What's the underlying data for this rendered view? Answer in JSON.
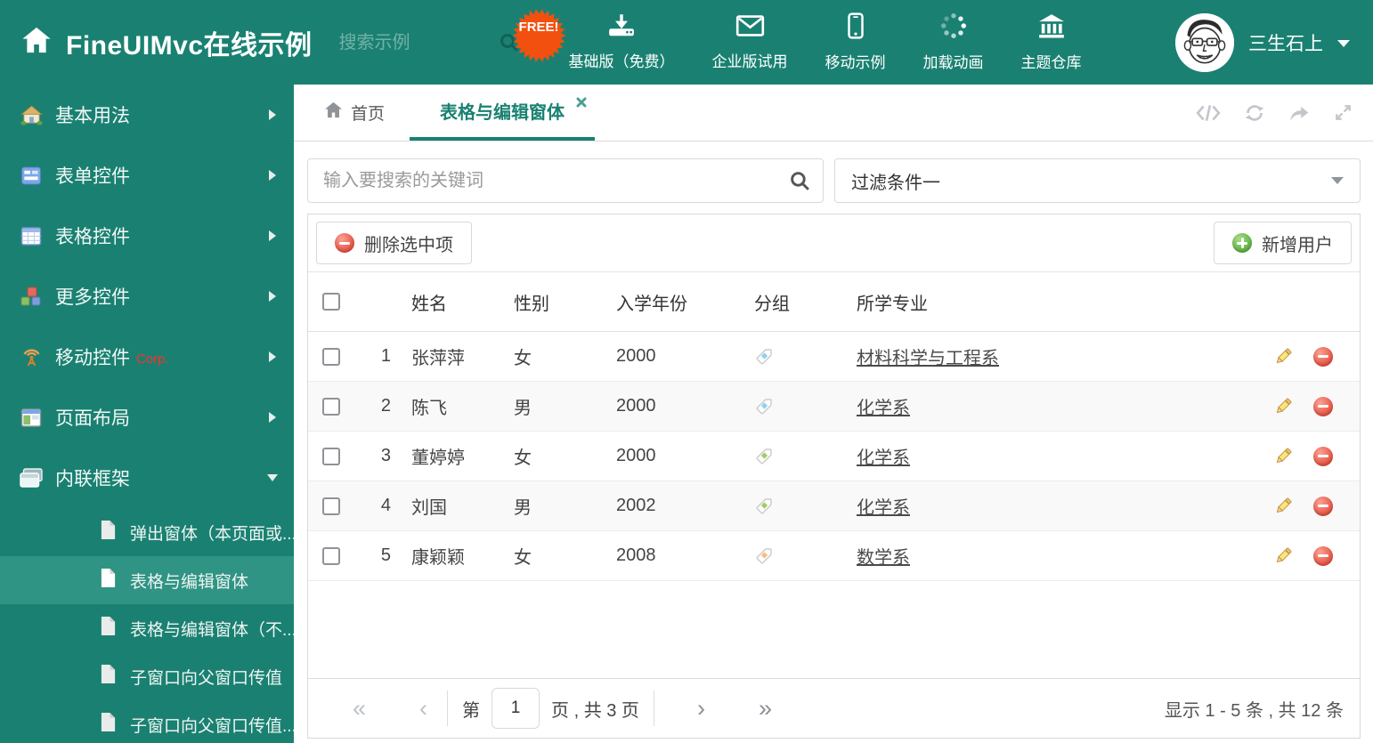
{
  "colors": {
    "accent": "#1a8172",
    "badge": "#f2500f",
    "add_green": "#57ae3d",
    "delete_red": "#e44c3c"
  },
  "header": {
    "title": "FineUIMvc在线示例",
    "search_placeholder": "搜索示例",
    "badge": "FREE!",
    "nav_items": [
      {
        "label": "基础版（免费）",
        "icon": "download-icon"
      },
      {
        "label": "企业版试用",
        "icon": "envelope-icon"
      },
      {
        "label": "移动示例",
        "icon": "mobile-icon"
      },
      {
        "label": "加载动画",
        "icon": "spinner-icon"
      },
      {
        "label": "主题仓库",
        "icon": "bank-icon"
      }
    ],
    "user": {
      "name": "三生石上",
      "avatar": "cartoon-face-avatar"
    }
  },
  "sidebar": {
    "items": [
      {
        "label": "基本用法",
        "icon": "house-icon"
      },
      {
        "label": "表单控件",
        "icon": "form-icon"
      },
      {
        "label": "表格控件",
        "icon": "table-icon"
      },
      {
        "label": "更多控件",
        "icon": "cubes-icon"
      },
      {
        "label": "移动控件",
        "suffix": "Corp.",
        "icon": "antenna-icon"
      },
      {
        "label": "页面布局",
        "icon": "layout-icon"
      },
      {
        "label": "内联框架",
        "icon": "frames-icon",
        "expanded": true
      }
    ],
    "subitems": [
      {
        "label": "弹出窗体（本页面或...",
        "icon": "file-icon"
      },
      {
        "label": "表格与编辑窗体",
        "icon": "file-icon",
        "selected": true
      },
      {
        "label": "表格与编辑窗体（不...",
        "icon": "file-icon"
      },
      {
        "label": "子窗口向父窗口传值",
        "icon": "file-icon"
      },
      {
        "label": "子窗口向父窗口传值...",
        "icon": "file-icon"
      }
    ]
  },
  "tabs": [
    {
      "label": "首页",
      "icon": "home-icon"
    },
    {
      "label": "表格与编辑窗体",
      "active": true,
      "closable": true
    }
  ],
  "tab_tools": [
    "code-icon",
    "refresh-icon",
    "share-icon",
    "expand-icon"
  ],
  "filter": {
    "search_placeholder": "输入要搜索的关键词",
    "dropdown_value": "过滤条件一"
  },
  "grid": {
    "toolbar": {
      "delete_label": "删除选中项",
      "add_label": "新增用户"
    },
    "columns": [
      "姓名",
      "性别",
      "入学年份",
      "分组",
      "所学专业"
    ],
    "rows": [
      {
        "num": "1",
        "name": "张萍萍",
        "gender": "女",
        "year": "2000",
        "tag_color": "#8ed0f5",
        "major": "材料科学与工程系"
      },
      {
        "num": "2",
        "name": "陈飞",
        "gender": "男",
        "year": "2000",
        "tag_color": "#8ed0f5",
        "major": "化学系"
      },
      {
        "num": "3",
        "name": "董婷婷",
        "gender": "女",
        "year": "2000",
        "tag_color": "#9ccf68",
        "major": "化学系"
      },
      {
        "num": "4",
        "name": "刘国",
        "gender": "男",
        "year": "2002",
        "tag_color": "#9ccf68",
        "major": "化学系"
      },
      {
        "num": "5",
        "name": "康颖颖",
        "gender": "女",
        "year": "2008",
        "tag_color": "#f9bc7c",
        "major": "数学系"
      }
    ],
    "pagination": {
      "first": "«",
      "prev": "‹",
      "next": "›",
      "last": "»",
      "page_prefix": "第",
      "page_value": "1",
      "page_suffix": "页 , 共 3 页",
      "summary": "显示 1 - 5 条 , 共 12 条"
    }
  }
}
